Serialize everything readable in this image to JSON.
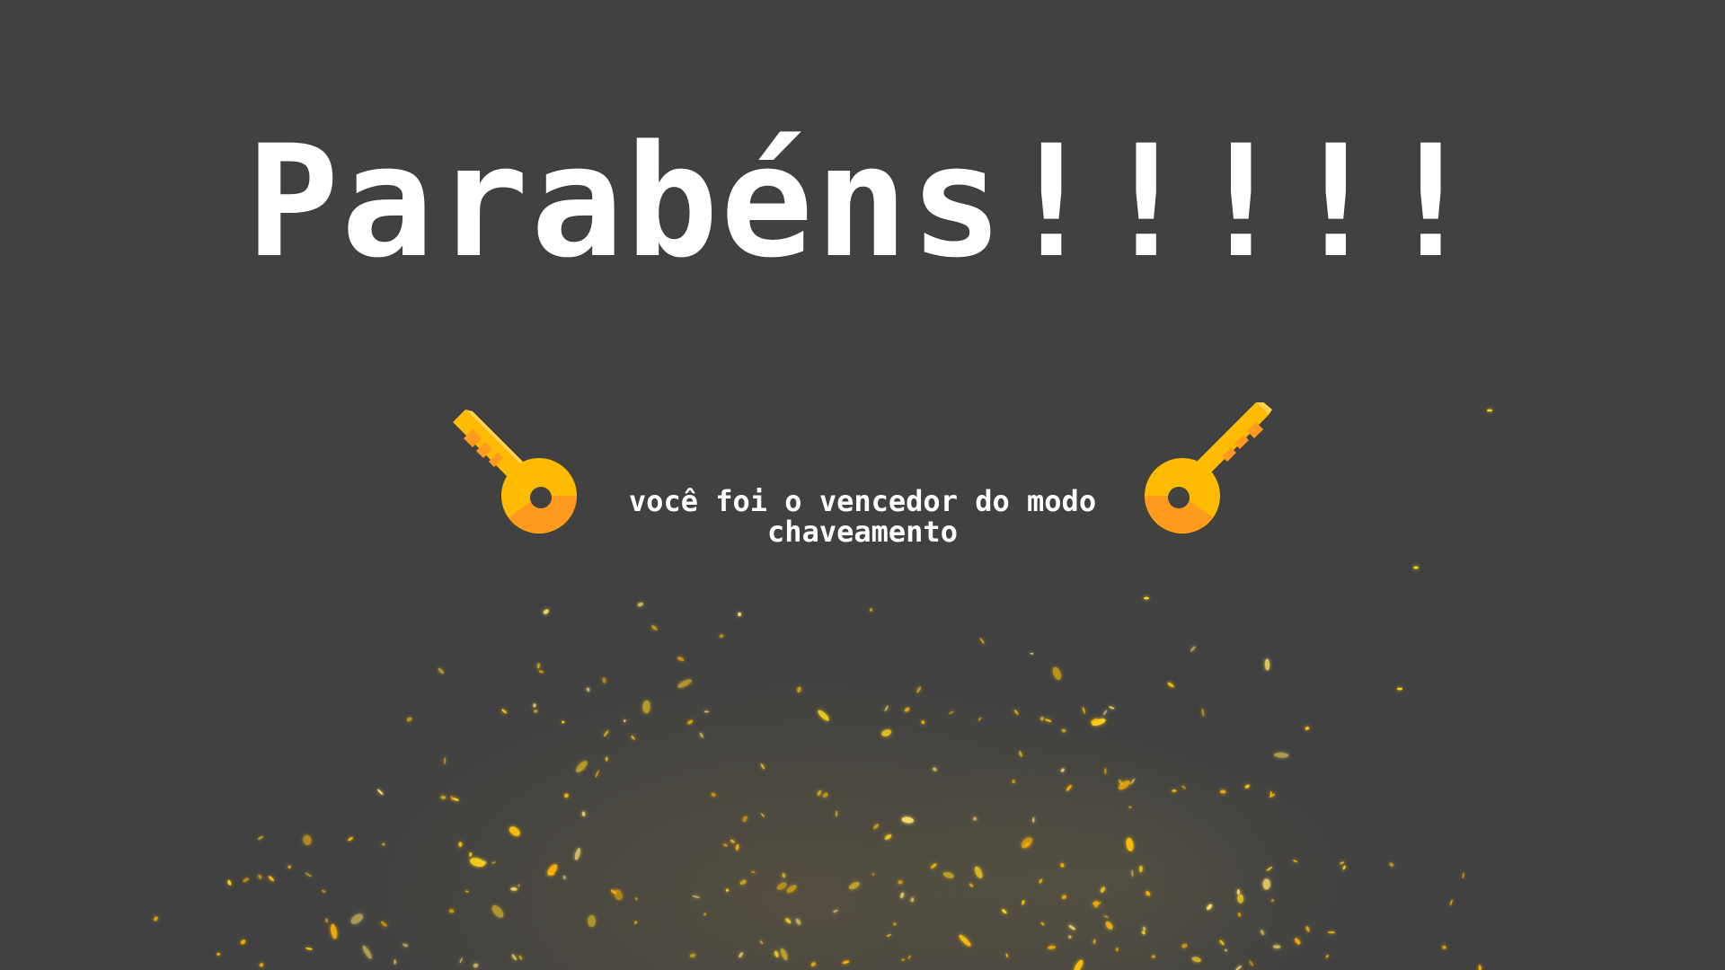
{
  "screen": {
    "title": "Parabéns!!!!!",
    "subtitle": "você foi o vencedor do modo chaveamento"
  },
  "icons": {
    "left": "key-icon",
    "right": "key-icon"
  },
  "colors": {
    "background": "#414141",
    "title": "#ffffff",
    "key_main": "#FFBB00",
    "key_shade": "#FF9A1F",
    "spark": "#FFD21A"
  }
}
